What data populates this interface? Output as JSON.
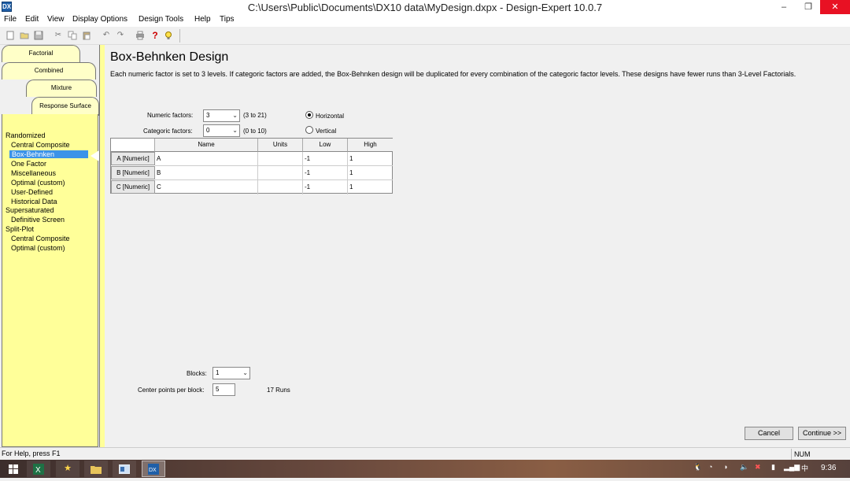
{
  "window": {
    "title": "C:\\Users\\Public\\Documents\\DX10 data\\MyDesign.dxpx - Design-Expert 10.0.7",
    "app_icon": "DX",
    "minimize": "–",
    "restore": "❐",
    "close": "✕"
  },
  "menu": [
    "File",
    "Edit",
    "View",
    "Display Options",
    "Design Tools",
    "Help",
    "Tips"
  ],
  "toolbar_icons": [
    "new-icon",
    "open-icon",
    "save-icon",
    "cut-icon",
    "copy-icon",
    "paste-icon",
    "undo-icon",
    "redo-icon",
    "print-icon",
    "help-icon",
    "tip-icon"
  ],
  "tabs": {
    "factorial": "Factorial",
    "combined": "Combined",
    "mixture": "Mixture",
    "response": "Response Surface"
  },
  "tree": {
    "randomized": "Randomized",
    "central_composite": "Central Composite",
    "box_behnken": "Box-Behnken",
    "one_factor": "One Factor",
    "miscellaneous": "Miscellaneous",
    "optimal_custom": "Optimal (custom)",
    "user_defined": "User-Defined",
    "historical_data": "Historical Data",
    "supersaturated": "Supersaturated",
    "definitive_screen": "Definitive Screen",
    "split_plot": "Split-Plot",
    "sp_central_composite": "Central Composite",
    "sp_optimal_custom": "Optimal (custom)"
  },
  "main": {
    "title": "Box-Behnken Design",
    "description": "Each numeric factor is set to 3 levels. If categoric factors are added, the Box-Behnken design will be duplicated for every combination of the categoric factor levels. These designs have fewer runs than 3-Level Factorials.",
    "numeric_label": "Numeric factors:",
    "numeric_value": "3",
    "numeric_range": "(3 to 21)",
    "categoric_label": "Categoric factors:",
    "categoric_value": "0",
    "categoric_range": "(0 to 10)",
    "orientation_horizontal": "Horizontal",
    "orientation_vertical": "Vertical",
    "orientation_selected": "Horizontal"
  },
  "grid": {
    "headers": {
      "name": "Name",
      "units": "Units",
      "low": "Low",
      "high": "High"
    },
    "rows": [
      {
        "label": "A [Numeric]",
        "name": "A",
        "units": "",
        "low": "-1",
        "high": "1"
      },
      {
        "label": "B [Numeric]",
        "name": "B",
        "units": "",
        "low": "-1",
        "high": "1"
      },
      {
        "label": "C [Numeric]",
        "name": "C",
        "units": "",
        "low": "-1",
        "high": "1"
      }
    ]
  },
  "bottom": {
    "blocks_label": "Blocks:",
    "blocks_value": "1",
    "center_label": "Center points per block:",
    "center_value": "5",
    "runs_text": "17  Runs",
    "cancel": "Cancel",
    "continue": "Continue >>"
  },
  "status": {
    "help": "For Help, press F1",
    "num": "NUM"
  },
  "taskbar": {
    "clock": "9:36",
    "ime": "中"
  }
}
